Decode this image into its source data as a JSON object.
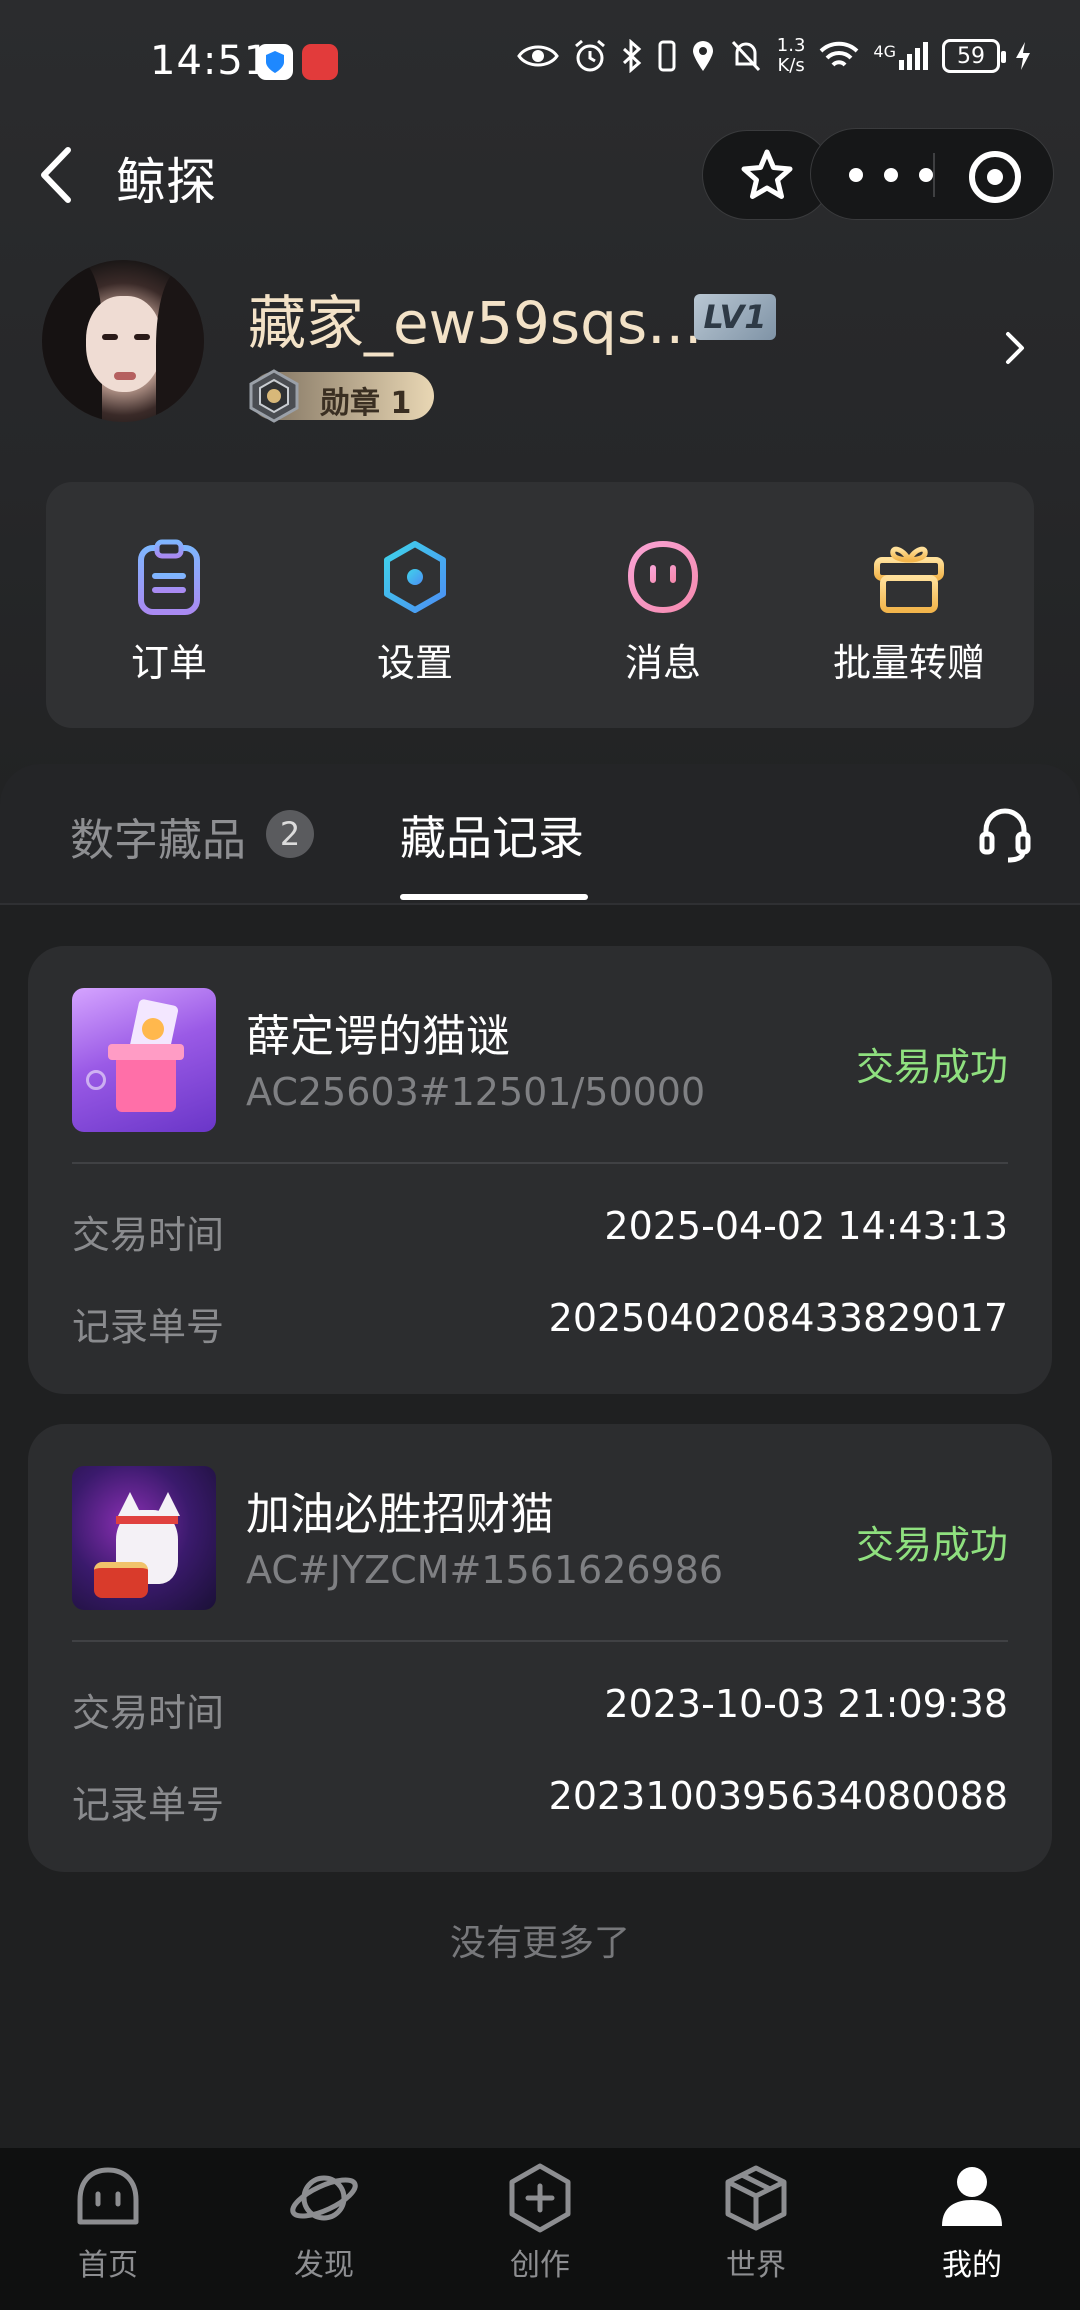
{
  "status_bar": {
    "time": "14:51",
    "net_speed_value": "1.3",
    "net_speed_unit": "K/s",
    "network": "4G",
    "battery": "59",
    "icons": [
      "eye-icon",
      "alarm-icon",
      "bluetooth-icon",
      "vibrate-icon",
      "location-icon",
      "mute-icon",
      "wifi-icon",
      "signal-icon",
      "charging-icon"
    ]
  },
  "nav": {
    "title": "鲸探"
  },
  "profile": {
    "username": "藏家_ew59sqs...",
    "level": "LV1",
    "medal_label": "勋章 1"
  },
  "quick_actions": [
    {
      "label": "订单",
      "icon": "clipboard-icon",
      "color": "#8f8cf5"
    },
    {
      "label": "设置",
      "icon": "hexagon-settings-icon",
      "color": "#4fb4f0"
    },
    {
      "label": "消息",
      "icon": "chat-face-icon",
      "color": "#f08ad0"
    },
    {
      "label": "批量转赠",
      "icon": "gift-icon",
      "color": "#f5c46b"
    }
  ],
  "tabs": {
    "collections": "数字藏品",
    "collections_count": "2",
    "records": "藏品记录"
  },
  "records": [
    {
      "name": "薛定谔的猫谜",
      "code": "AC25603#12501/50000",
      "status": "交易成功",
      "time_label": "交易时间",
      "time": "2025-04-02 14:43:13",
      "id_label": "记录单号",
      "record_id": "2025040208433829017"
    },
    {
      "name": "加油必胜招财猫",
      "code": "AC#JYZCM#1561626986",
      "status": "交易成功",
      "time_label": "交易时间",
      "time": "2023-10-03 21:09:38",
      "id_label": "记录单号",
      "record_id": "2023100395634080088"
    }
  ],
  "footer_text": "没有更多了",
  "bottom_nav": [
    {
      "label": "首页",
      "icon": "home-icon"
    },
    {
      "label": "发现",
      "icon": "planet-icon"
    },
    {
      "label": "创作",
      "icon": "create-plus-icon"
    },
    {
      "label": "世界",
      "icon": "cube-icon"
    },
    {
      "label": "我的",
      "icon": "profile-icon",
      "active": true
    }
  ],
  "colors": {
    "success": "#8fe07f",
    "username": "#f3e2c7",
    "background": "#1f2021"
  }
}
